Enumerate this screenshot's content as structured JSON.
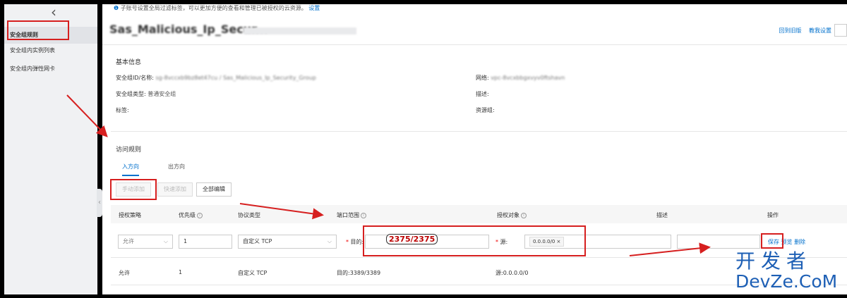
{
  "sidebar": {
    "back_icon": "chevron-left-icon",
    "items": [
      {
        "label": "安全组规则"
      },
      {
        "label": "安全组内实例列表"
      },
      {
        "label": "安全组内弹性网卡"
      }
    ]
  },
  "notice": {
    "text": "子账号设置全局过滤标签，可以更加方便的查看和管理已被授权的云资源。",
    "link": "设置"
  },
  "header": {
    "title": "Sas_Malicious_Ip_Secur...",
    "links": [
      "回到旧版",
      "教我设置"
    ]
  },
  "basic_info": {
    "heading": "基本信息",
    "id_label": "安全组ID/名称:",
    "id_value": "sg-8vccxb9bz8et47cu / Sas_Malicious_Ip_Security_Group",
    "type_label": "安全组类型:",
    "type_value": "普通安全组",
    "tag_label": "标签:",
    "network_label": "网络:",
    "network_value": "vpc-8vcxbbgxvyv0ftshavn",
    "desc_label": "描述:",
    "resource_label": "资源组:"
  },
  "rules": {
    "heading": "访问规则",
    "tabs": [
      "入方向",
      "出方向"
    ],
    "buttons": [
      "手动添加",
      "快速添加",
      "全部编辑"
    ],
    "columns": [
      "授权策略",
      "优先级",
      "协议类型",
      "端口范围",
      "授权对象",
      "描述",
      "操作"
    ],
    "edit_row": {
      "policy": "允许",
      "priority": "1",
      "protocol": "自定义 TCP",
      "port_label": "目的:",
      "port_value": "2375/2375",
      "source_label": "源:",
      "source_value": "0.0.0.0/0",
      "actions": [
        "保存",
        "预览",
        "删除"
      ]
    },
    "existing_row": {
      "policy": "允许",
      "priority": "1",
      "protocol": "自定义 TCP",
      "port": "目的:3389/3389",
      "source": "源:0.0.0.0/0"
    }
  },
  "watermark": {
    "cn": "开发者",
    "en": "DevZe.CoM"
  },
  "colors": {
    "accent": "#0070cc",
    "annotation_red": "#d61f1f",
    "sidebar_bg": "#f0f1f3"
  }
}
